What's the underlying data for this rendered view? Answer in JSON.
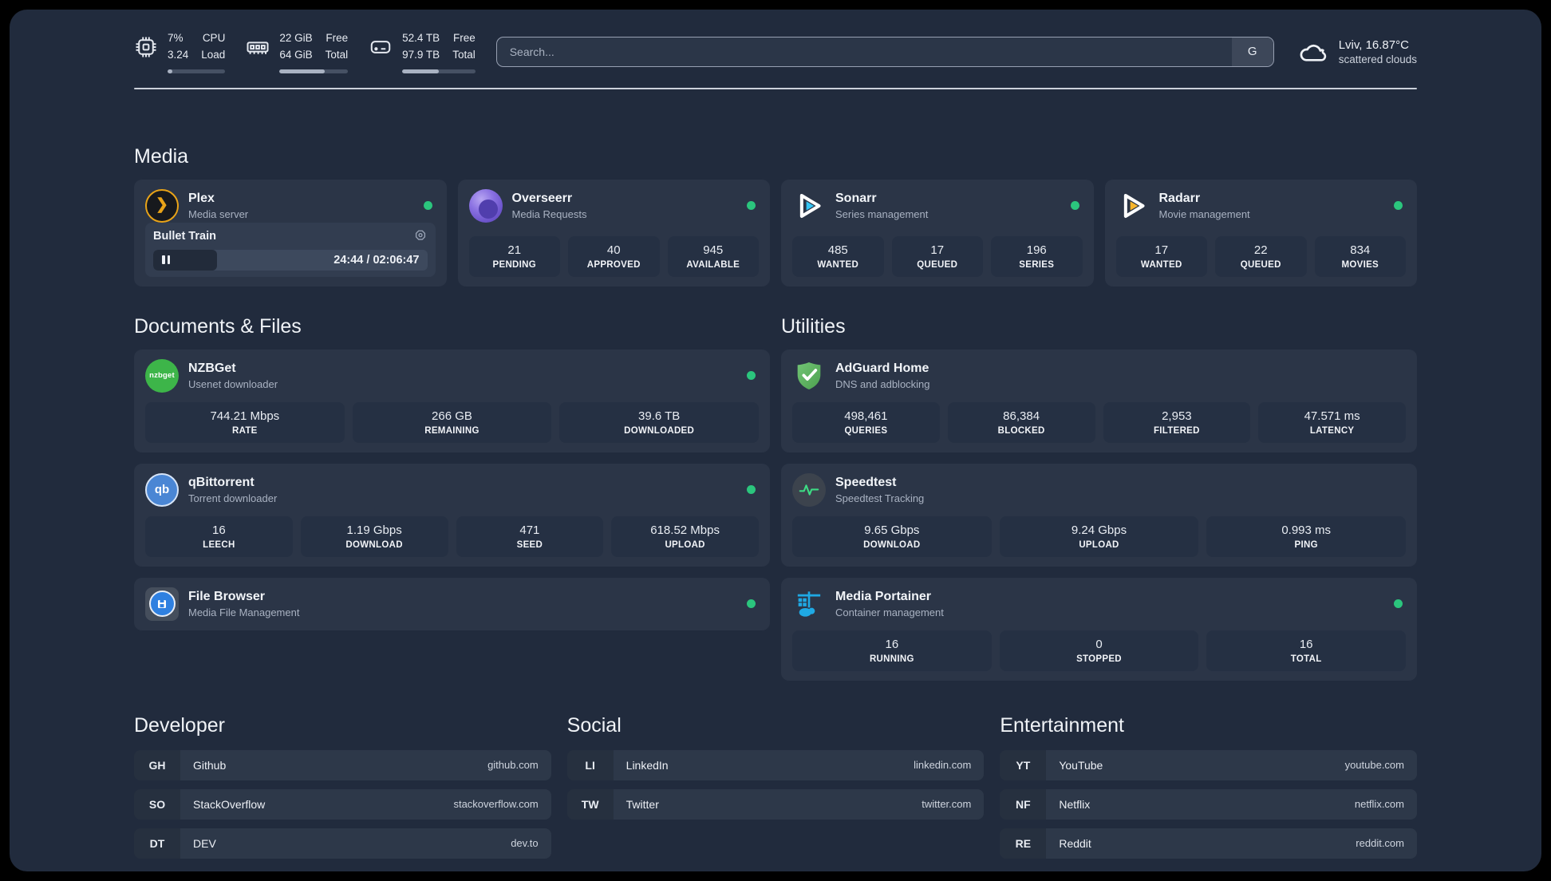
{
  "colors": {
    "page_bg": "#212b3d",
    "card_bg": "#2b3547",
    "tile_bg": "#253043",
    "status_ok": "#2bc57d",
    "accent_plex": "#e8a318",
    "accent_sonarr": "#35c5f4",
    "accent_radarr": "#f7b52c"
  },
  "header": {
    "system_stats": [
      {
        "icon": "cpu-icon",
        "values": [
          "7%",
          "3.24"
        ],
        "labels": [
          "CPU",
          "Load"
        ],
        "progress_pct": 8
      },
      {
        "icon": "ram-icon",
        "values": [
          "22 GiB",
          "64 GiB"
        ],
        "labels": [
          "Free",
          "Total"
        ],
        "progress_pct": 66
      },
      {
        "icon": "disk-icon",
        "values": [
          "52.4 TB",
          "97.9 TB"
        ],
        "labels": [
          "Free",
          "Total"
        ],
        "progress_pct": 50
      }
    ],
    "search": {
      "placeholder": "Search...",
      "engine_button": "G"
    },
    "weather": {
      "summary": "Lviv, 16.87°C",
      "condition": "scattered clouds"
    }
  },
  "sections": {
    "media": {
      "title": "Media"
    },
    "documents": {
      "title": "Documents & Files"
    },
    "utilities": {
      "title": "Utilities"
    }
  },
  "apps": {
    "plex": {
      "name": "Plex",
      "subtitle": "Media server",
      "status": "online",
      "player": {
        "title": "Bullet Train",
        "time_display": "24:44 / 02:06:47",
        "progress_pct": 20,
        "state": "paused"
      }
    },
    "overseerr": {
      "name": "Overseerr",
      "subtitle": "Media Requests",
      "status": "online",
      "stats": [
        {
          "value": "21",
          "label": "PENDING"
        },
        {
          "value": "40",
          "label": "APPROVED"
        },
        {
          "value": "945",
          "label": "AVAILABLE"
        }
      ]
    },
    "sonarr": {
      "name": "Sonarr",
      "subtitle": "Series management",
      "status": "online",
      "stats": [
        {
          "value": "485",
          "label": "WANTED"
        },
        {
          "value": "17",
          "label": "QUEUED"
        },
        {
          "value": "196",
          "label": "SERIES"
        }
      ]
    },
    "radarr": {
      "name": "Radarr",
      "subtitle": "Movie management",
      "status": "online",
      "stats": [
        {
          "value": "17",
          "label": "WANTED"
        },
        {
          "value": "22",
          "label": "QUEUED"
        },
        {
          "value": "834",
          "label": "MOVIES"
        }
      ]
    },
    "nzbget": {
      "name": "NZBGet",
      "subtitle": "Usenet downloader",
      "status": "online",
      "icon_text": "nzbget",
      "stats": [
        {
          "value": "744.21 Mbps",
          "label": "RATE"
        },
        {
          "value": "266 GB",
          "label": "REMAINING"
        },
        {
          "value": "39.6 TB",
          "label": "DOWNLOADED"
        }
      ]
    },
    "qbittorrent": {
      "name": "qBittorrent",
      "subtitle": "Torrent downloader",
      "status": "online",
      "icon_text": "qb",
      "stats": [
        {
          "value": "16",
          "label": "LEECH"
        },
        {
          "value": "1.19 Gbps",
          "label": "DOWNLOAD"
        },
        {
          "value": "471",
          "label": "SEED"
        },
        {
          "value": "618.52 Mbps",
          "label": "UPLOAD"
        }
      ]
    },
    "filebrowser": {
      "name": "File Browser",
      "subtitle": "Media File Management",
      "status": "online"
    },
    "adguard": {
      "name": "AdGuard Home",
      "subtitle": "DNS and adblocking",
      "stats": [
        {
          "value": "498,461",
          "label": "QUERIES"
        },
        {
          "value": "86,384",
          "label": "BLOCKED"
        },
        {
          "value": "2,953",
          "label": "FILTERED"
        },
        {
          "value": "47.571 ms",
          "label": "LATENCY"
        }
      ]
    },
    "speedtest": {
      "name": "Speedtest",
      "subtitle": "Speedtest Tracking",
      "stats": [
        {
          "value": "9.65 Gbps",
          "label": "DOWNLOAD"
        },
        {
          "value": "9.24 Gbps",
          "label": "UPLOAD"
        },
        {
          "value": "0.993 ms",
          "label": "PING"
        }
      ]
    },
    "portainer": {
      "name": "Media Portainer",
      "subtitle": "Container management",
      "status": "online",
      "stats": [
        {
          "value": "16",
          "label": "RUNNING"
        },
        {
          "value": "0",
          "label": "STOPPED"
        },
        {
          "value": "16",
          "label": "TOTAL"
        }
      ]
    }
  },
  "bookmarks": {
    "developer": {
      "title": "Developer",
      "links": [
        {
          "abbr": "GH",
          "name": "Github",
          "url": "github.com"
        },
        {
          "abbr": "SO",
          "name": "StackOverflow",
          "url": "stackoverflow.com"
        },
        {
          "abbr": "DT",
          "name": "DEV",
          "url": "dev.to"
        }
      ]
    },
    "social": {
      "title": "Social",
      "links": [
        {
          "abbr": "LI",
          "name": "LinkedIn",
          "url": "linkedin.com"
        },
        {
          "abbr": "TW",
          "name": "Twitter",
          "url": "twitter.com"
        }
      ]
    },
    "entertainment": {
      "title": "Entertainment",
      "links": [
        {
          "abbr": "YT",
          "name": "YouTube",
          "url": "youtube.com"
        },
        {
          "abbr": "NF",
          "name": "Netflix",
          "url": "netflix.com"
        },
        {
          "abbr": "RE",
          "name": "Reddit",
          "url": "reddit.com"
        }
      ]
    }
  }
}
